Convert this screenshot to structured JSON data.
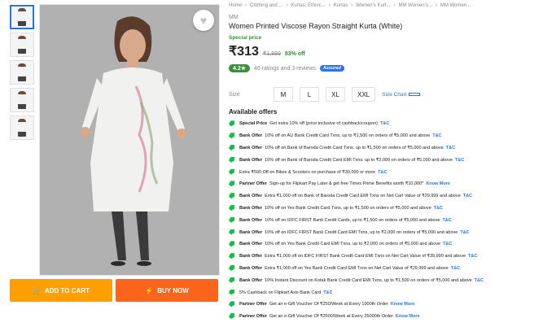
{
  "breadcrumbs": [
    "Home",
    "Clothing and ...",
    "Kurtas, Ethnic...",
    "Kurtas",
    "Women's Kurt...",
    "MM Women's...",
    "MM Women..."
  ],
  "product": {
    "brand": "MM",
    "title": "Women Printed Viscose Rayon Straight Kurta  (White)",
    "special_price_label": "Special price",
    "price": "₹313",
    "mrp": "₹1,899",
    "discount": "83% off",
    "rating": "4.2★",
    "ratings_reviews": "46 ratings and 3 reviews",
    "assured": "Assured"
  },
  "actions": {
    "add_to_cart": "ADD TO CART",
    "buy_now": "BUY NOW"
  },
  "size": {
    "label": "Size",
    "options": [
      "M",
      "L",
      "XL",
      "XXL"
    ],
    "chart_label": "Size Chart"
  },
  "offers_title": "Available offers",
  "offers": [
    {
      "type": "Special Price",
      "text": "Get extra 10% off (price inclusive of cashback/coupon)",
      "link": "T&C"
    },
    {
      "type": "Bank Offer",
      "text": "10% off on AU Bank Credit Card Txns, up to ₹1,500 on orders of ₹5,000 and above",
      "link": "T&C"
    },
    {
      "type": "Bank Offer",
      "text": "10% off on Bank of Baroda Credit Card Txns, up to ₹1,500 on orders of ₹5,000 and above",
      "link": "T&C"
    },
    {
      "type": "Bank Offer",
      "text": "10% off on Bank of Baroda Credit Card EMI Txns, up to ₹2,000 on orders of ₹5,000 and above",
      "link": "T&C"
    },
    {
      "type": "",
      "text": "Extra ₹500 Off on Bikes & Scooters on purchase of ₹30,000 or more",
      "link": "T&C"
    },
    {
      "type": "Partner Offer",
      "text": "Sign-up for Flipkart Pay Later & get free Times Prime Benefits worth ₹10,000*",
      "link": "Know More"
    },
    {
      "type": "Bank Offer",
      "text": "Extra ₹1,000 off on Bank of Baroda Credit Card EMI Txns on Net Cart Value of ₹29,999 and above",
      "link": "T&C"
    },
    {
      "type": "Bank Offer",
      "text": "10% off on Yes Bank Credit Card Txns, up to ₹1,500 on orders of ₹5,000 and above",
      "link": "T&C"
    },
    {
      "type": "Bank Offer",
      "text": "10% off on IDFC FIRST Bank Credit Cards, up to ₹1,500 on orders of ₹5,000 and above",
      "link": "T&C"
    },
    {
      "type": "Bank Offer",
      "text": "10% off on IDFC FIRST Bank Credit Card EMI Txns, up to ₹2,000 on orders of ₹5,000 and above",
      "link": "T&C"
    },
    {
      "type": "Bank Offer",
      "text": "10% off on Yes Bank Credit Card EMI Txns, up to ₹2,000 on orders of ₹5,000 and above",
      "link": "T&C"
    },
    {
      "type": "Bank Offer",
      "text": "Extra ₹1,000 off on IDFC FIRST Bank Credit Card EMI Txns on Net Cart Value of ₹39,999 and above",
      "link": "T&C"
    },
    {
      "type": "Bank Offer",
      "text": "Extra ₹1,000 off on Yes Bank Credit Card EMI Txns on Net Cart Value of ₹29,999 and above",
      "link": "T&C"
    },
    {
      "type": "Bank Offer",
      "text": "10% Instant Discount on Kotak Bank Credit Card EMI Txns, up to ₹1,500 on orders of ₹5,000 and above",
      "link": "T&C"
    },
    {
      "type": "",
      "text": "5% Cashback on Flipkart Axis Bank Card",
      "link": "T&C"
    },
    {
      "type": "Partner Offer",
      "text": "Get an e-Gift Voucher Of ₹250/Week at Every 1000th Order",
      "link": "Know More"
    },
    {
      "type": "Partner Offer",
      "text": "Get an e-Gift Voucher Of ₹2500/Week at Every 25000th Order",
      "link": "Know More"
    }
  ],
  "colors": {
    "primary": "#2874f0",
    "cart": "#ff9f00",
    "buy": "#fb641b",
    "green": "#388e3c"
  }
}
